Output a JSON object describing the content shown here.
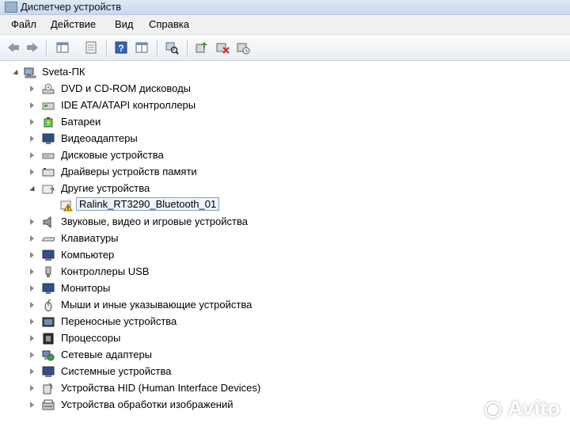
{
  "window": {
    "title": "Диспетчер устройств"
  },
  "menu": [
    "Файл",
    "Действие",
    "Вид",
    "Справка"
  ],
  "toolbar_icons": [
    "back-icon",
    "forward-icon",
    "properties-pane-icon",
    "console-tree-icon",
    "help-icon",
    "view-icon",
    "scan-hardware-icon",
    "update-driver-icon",
    "uninstall-icon",
    "disable-icon"
  ],
  "tree": {
    "root": "Sveta-ПК",
    "categories": [
      "DVD и CD-ROM дисководы",
      "IDE ATA/ATAPI контроллеры",
      "Батареи",
      "Видеоадаптеры",
      "Дисковые устройства",
      "Драйверы устройств памяти",
      "Другие устройства",
      "Звуковые, видео и игровые устройства",
      "Клавиатуры",
      "Компьютер",
      "Контроллеры USB",
      "Мониторы",
      "Мыши и иные указывающие устройства",
      "Переносные устройства",
      "Процессоры",
      "Сетевые адаптеры",
      "Системные устройства",
      "Устройства HID (Human Interface Devices)",
      "Устройства обработки изображений"
    ],
    "other_devices_child": "Ralink_RT3290_Bluetooth_01"
  },
  "watermark": "Avito"
}
